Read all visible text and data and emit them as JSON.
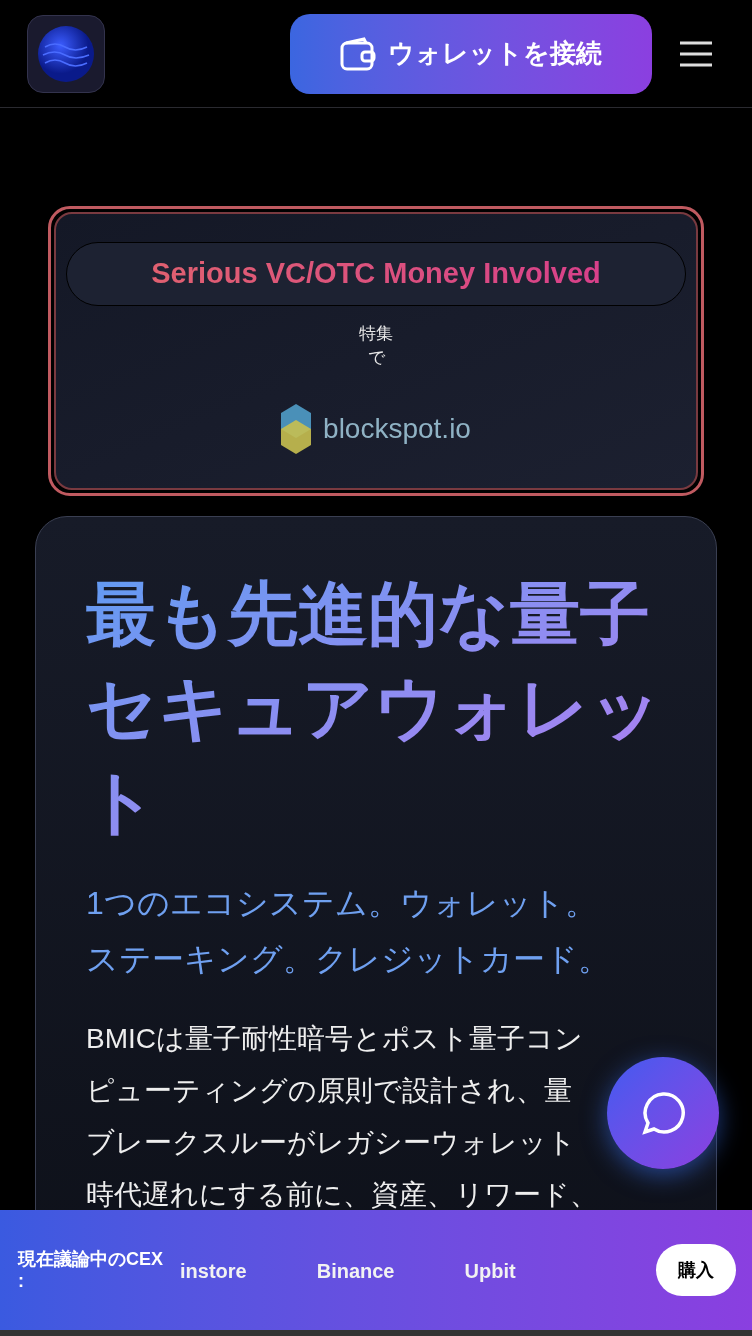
{
  "header": {
    "connect_button": "ウォレットを接続"
  },
  "featured": {
    "badge": "Serious VC/OTC Money Involved",
    "label_lines": [
      "特集",
      "で"
    ],
    "brand": "blockspot.io"
  },
  "hero": {
    "title": "最も先進的な量子セキュアウォレット",
    "subtitle_lines": [
      "1つのエコシステム。ウォレット。",
      "ステーキング。クレジットカード。"
    ],
    "paragraph_lines": [
      "BMICは量子耐性暗号とポスト量子コン",
      "ピューティングの原則で設計され、量",
      "ブレークスルーがレガシーウォレット",
      "時代遅れにする前に、資産、リワード、"
    ]
  },
  "ticker": {
    "label_lines": [
      "現在議論中のCEX",
      ":"
    ],
    "items": [
      "instore",
      "Binance",
      "Upbit"
    ],
    "buy_button": "購入"
  }
}
